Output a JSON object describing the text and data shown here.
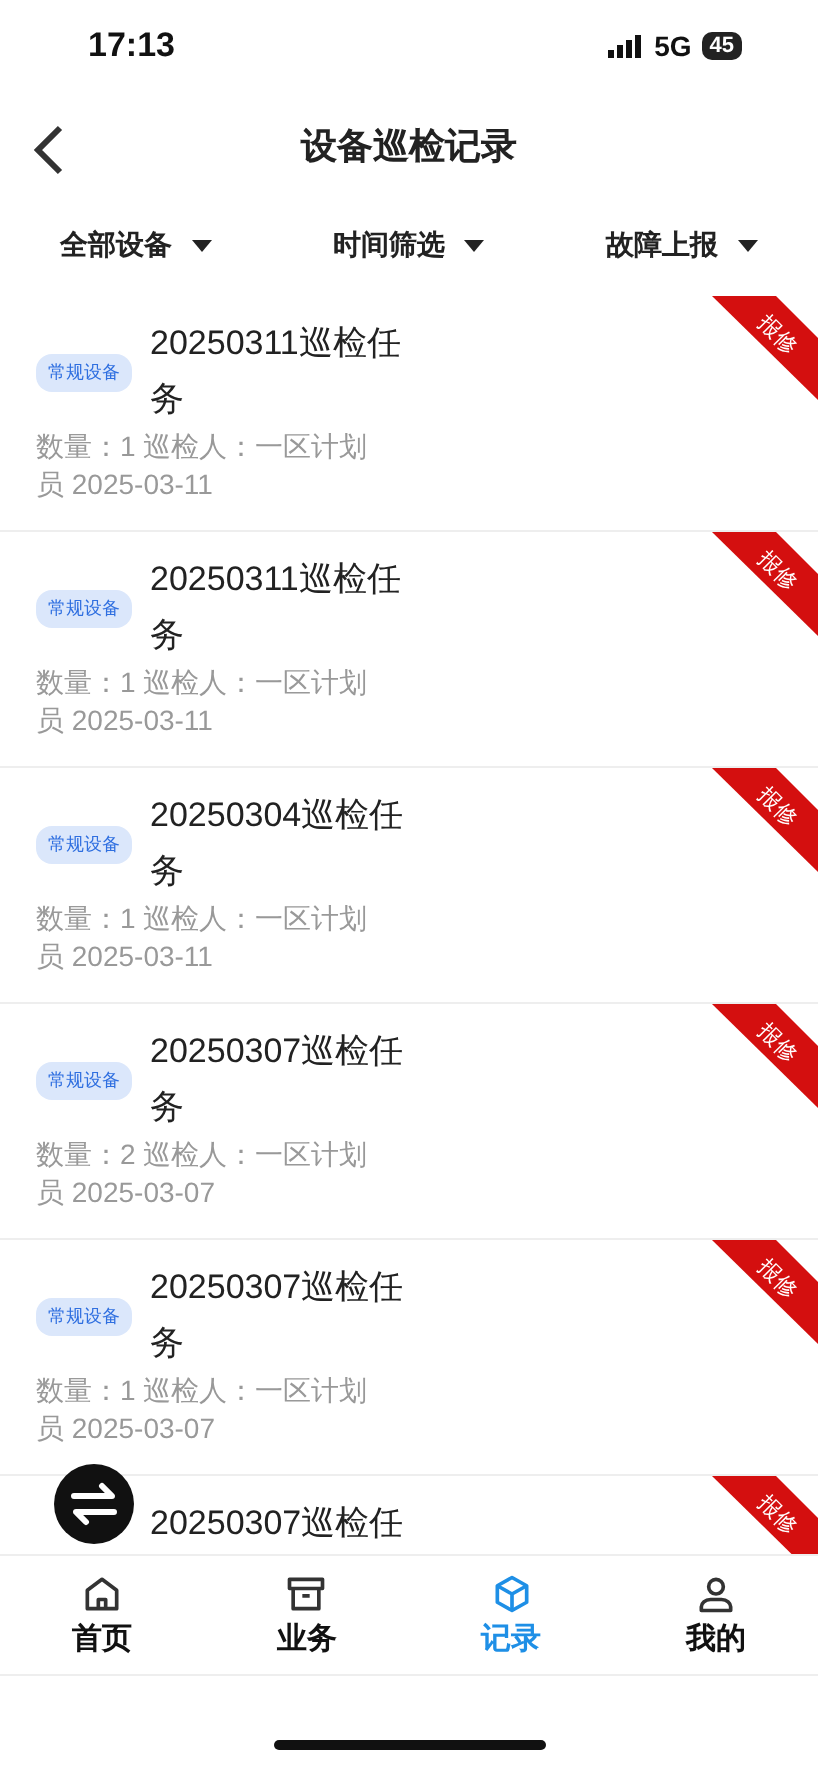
{
  "status_bar": {
    "time": "17:13",
    "network": "5G",
    "battery": "45"
  },
  "header": {
    "title": "设备巡检记录"
  },
  "filters": [
    {
      "label": "全部设备"
    },
    {
      "label": "时间筛选"
    },
    {
      "label": "故障上报"
    }
  ],
  "records": [
    {
      "tag": "常规设备",
      "title": "20250311巡检任务",
      "meta": "数量：1 巡检人：一区计划员 2025-03-11",
      "ribbon": "报修"
    },
    {
      "tag": "常规设备",
      "title": "20250311巡检任务",
      "meta": "数量：1 巡检人：一区计划员 2025-03-11",
      "ribbon": "报修"
    },
    {
      "tag": "常规设备",
      "title": "20250304巡检任务",
      "meta": "数量：1 巡检人：一区计划员 2025-03-11",
      "ribbon": "报修"
    },
    {
      "tag": "常规设备",
      "title": "20250307巡检任务",
      "meta": "数量：2 巡检人：一区计划员 2025-03-07",
      "ribbon": "报修"
    },
    {
      "tag": "常规设备",
      "title": "20250307巡检任务",
      "meta": "数量：1 巡检人：一区计划员 2025-03-07",
      "ribbon": "报修"
    },
    {
      "title": "20250307巡检任",
      "ribbon": "报修"
    }
  ],
  "nav": [
    {
      "label": "首页",
      "selected": false
    },
    {
      "label": "业务",
      "selected": false
    },
    {
      "label": "记录",
      "selected": true
    },
    {
      "label": "我的",
      "selected": false
    }
  ]
}
